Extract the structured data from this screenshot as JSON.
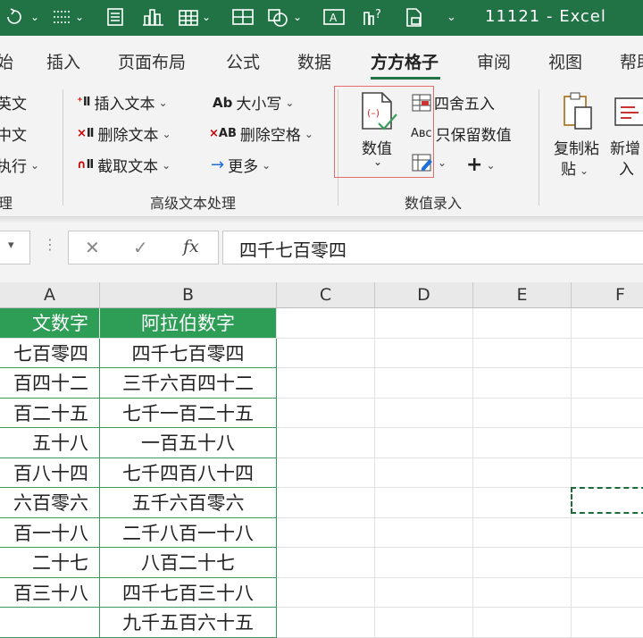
{
  "titlebar": {
    "title": "11121 - Excel",
    "icons": [
      "undo-dropdown-icon",
      "border-icon",
      "form-icon",
      "bar-chart-icon",
      "table-icon",
      "pivot-icon",
      "shape-icon",
      "text-frame-icon",
      "chart-question-icon",
      "document-lock-icon",
      "customize-qat-icon"
    ]
  },
  "tabs": [
    "始",
    "插入",
    "页面布局",
    "公式",
    "数据",
    "方方格子",
    "审阅",
    "视图",
    "帮助"
  ],
  "active_tab": "方方格子",
  "ribbon": {
    "left_partial": [
      "英文",
      "中文",
      "执行"
    ],
    "left_group_partial": "理",
    "text_group": {
      "insert_text": "插入文本",
      "delete_text": "删除文本",
      "extract_text": "截取文本",
      "case": "大小写",
      "delete_space": "删除空格",
      "more": "更多",
      "label": "高级文本处理"
    },
    "value_group": {
      "value_btn": "数值",
      "round": "四舍五入",
      "keep_values": "只保留数值",
      "plus": "+",
      "label": "数值录入"
    },
    "paste_btn": [
      "复制粘",
      "贴"
    ],
    "new_btn": [
      "新增",
      "入"
    ]
  },
  "formula_bar": {
    "cancel": "✕",
    "confirm": "✓",
    "fx": "fx",
    "value": "四千七百零四"
  },
  "columns": [
    "A",
    "B",
    "C",
    "D",
    "E",
    "F"
  ],
  "table": {
    "headers": [
      "文数字",
      "阿拉伯数字"
    ],
    "rows": [
      [
        "七百零四",
        "四千七百零四"
      ],
      [
        "百四十二",
        "三千六百四十二"
      ],
      [
        "百二十五",
        "七千一百二十五"
      ],
      [
        "五十八",
        "一百五十八"
      ],
      [
        "百八十四",
        "七千四百八十四"
      ],
      [
        "六百零六",
        "五千六百零六"
      ],
      [
        "百一十八",
        "二千八百一十八"
      ],
      [
        "二十七",
        "八百二十七"
      ],
      [
        "百三十八",
        "四千七百三十八"
      ],
      [
        "",
        "九千五百六十五"
      ]
    ]
  },
  "colors": {
    "excel_green": "#217346",
    "table_header": "#2e9e57",
    "highlight_box": "#e86b6b"
  }
}
